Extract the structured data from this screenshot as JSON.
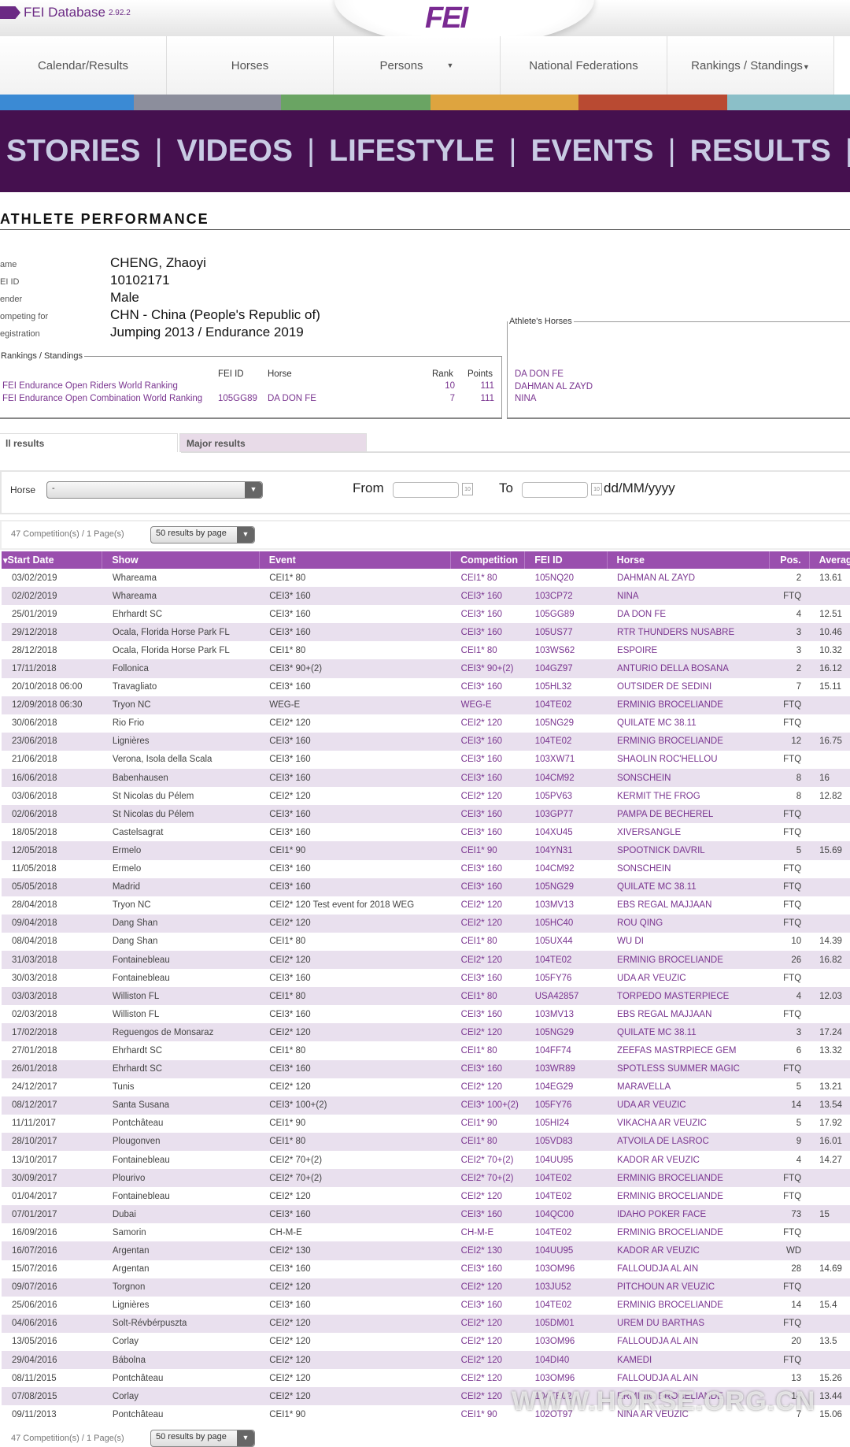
{
  "app": {
    "name": "FEI Database",
    "version": "2.92.2",
    "logo": "FEI"
  },
  "nav": [
    {
      "label": "Calendar/Results"
    },
    {
      "label": "Horses"
    },
    {
      "label": "Persons",
      "dropdown": true
    },
    {
      "label": "National Federations"
    },
    {
      "label": "Rankings / Standings",
      "dropdown": true
    }
  ],
  "stripe_colors": [
    "#3b8ad4",
    "#8c8e9c",
    "#6aa463",
    "#dea43f",
    "#b94a32",
    "#8bbfc8"
  ],
  "banner": [
    "STORIES",
    "VIDEOS",
    "LIFESTYLE",
    "EVENTS",
    "RESULTS"
  ],
  "page_title": "ATHLETE PERFORMANCE",
  "athlete": [
    {
      "label": "ame",
      "value": "CHENG, Zhaoyi"
    },
    {
      "label": "EI ID",
      "value": "10102171"
    },
    {
      "label": "ender",
      "value": "Male"
    },
    {
      "label": "ompeting for",
      "value": "CHN - China (People's Republic of)"
    },
    {
      "label": "egistration",
      "value": "Jumping 2013 / Endurance 2019"
    }
  ],
  "rankings": {
    "legend": "Rankings / Standings",
    "headers": {
      "fei_id": "FEI ID",
      "horse": "Horse",
      "rank": "Rank",
      "points": "Points"
    },
    "rows": [
      {
        "name": "FEI Endurance Open Riders World Ranking",
        "fei_id": "",
        "horse": "",
        "rank": "10",
        "points": "111"
      },
      {
        "name": "FEI Endurance Open Combination World Ranking",
        "fei_id": "105GG89",
        "horse": "DA DON FE",
        "rank": "7",
        "points": "111"
      }
    ]
  },
  "athletes_horses": {
    "legend": "Athlete's Horses",
    "items": [
      "DA DON FE",
      "DAHMAN AL ZAYD",
      "NINA"
    ]
  },
  "tabs": [
    {
      "label": "ll results",
      "active": true
    },
    {
      "label": "Major results",
      "active": false
    }
  ],
  "filter": {
    "horse_label": "Horse",
    "horse_value": "-",
    "from_label": "From",
    "to_label": "To",
    "date_format": "dd/MM/yyyy"
  },
  "summary": "47 Competition(s) / 1 Page(s)",
  "page_size": "50 results by page",
  "table": {
    "headers": [
      "Start Date",
      "Show",
      "Event",
      "Competition",
      "FEI ID",
      "Horse",
      "Pos.",
      "Average"
    ],
    "rows": [
      [
        "03/02/2019",
        "Whareama",
        "CEI1* 80",
        "CEI1* 80",
        "105NQ20",
        "DAHMAN AL ZAYD",
        "2",
        "13.61"
      ],
      [
        "02/02/2019",
        "Whareama",
        "CEI3* 160",
        "CEI3* 160",
        "103CP72",
        "NINA",
        "FTQ",
        ""
      ],
      [
        "25/01/2019",
        "Ehrhardt SC",
        "CEI3* 160",
        "CEI3* 160",
        "105GG89",
        "DA DON FE",
        "4",
        "12.51"
      ],
      [
        "29/12/2018",
        "Ocala, Florida Horse Park FL",
        "CEI3* 160",
        "CEI3* 160",
        "105US77",
        "RTR THUNDERS NUSABRE",
        "3",
        "10.46"
      ],
      [
        "28/12/2018",
        "Ocala, Florida Horse Park FL",
        "CEI1* 80",
        "CEI1* 80",
        "103WS62",
        "ESPOIRE",
        "3",
        "10.32"
      ],
      [
        "17/11/2018",
        "Follonica",
        "CEI3* 90+(2)",
        "CEI3* 90+(2)",
        "104GZ97",
        "ANTURIO DELLA BOSANA",
        "2",
        "16.12"
      ],
      [
        "20/10/2018 06:00",
        "Travagliato",
        "CEI3* 160",
        "CEI3* 160",
        "105HL32",
        "OUTSIDER DE SEDINI",
        "7",
        "15.11"
      ],
      [
        "12/09/2018 06:30",
        "Tryon NC",
        "WEG-E",
        "WEG-E",
        "104TE02",
        "ERMINIG BROCELIANDE",
        "FTQ",
        ""
      ],
      [
        "30/06/2018",
        "Rio Frio",
        "CEI2* 120",
        "CEI2* 120",
        "105NG29",
        "QUILATE MC 38.11",
        "FTQ",
        ""
      ],
      [
        "23/06/2018",
        "Lignières",
        "CEI3* 160",
        "CEI3* 160",
        "104TE02",
        "ERMINIG BROCELIANDE",
        "12",
        "16.75"
      ],
      [
        "21/06/2018",
        "Verona, Isola della Scala",
        "CEI3* 160",
        "CEI3* 160",
        "103XW71",
        "SHAOLIN ROC'HELLOU",
        "FTQ",
        ""
      ],
      [
        "16/06/2018",
        "Babenhausen",
        "CEI3* 160",
        "CEI3* 160",
        "104CM92",
        "SONSCHEIN",
        "8",
        "16"
      ],
      [
        "03/06/2018",
        "St Nicolas du Pélem",
        "CEI2* 120",
        "CEI2* 120",
        "105PV63",
        "KERMIT THE FROG",
        "8",
        "12.82"
      ],
      [
        "02/06/2018",
        "St Nicolas du Pélem",
        "CEI3* 160",
        "CEI3* 160",
        "103GP77",
        "PAMPA DE BECHEREL",
        "FTQ",
        ""
      ],
      [
        "18/05/2018",
        "Castelsagrat",
        "CEI3* 160",
        "CEI3* 160",
        "104XU45",
        "XIVERSANGLE",
        "FTQ",
        ""
      ],
      [
        "12/05/2018",
        "Ermelo",
        "CEI1* 90",
        "CEI1* 90",
        "104YN31",
        "SPOOTNICK DAVRIL",
        "5",
        "15.69"
      ],
      [
        "11/05/2018",
        "Ermelo",
        "CEI3* 160",
        "CEI3* 160",
        "104CM92",
        "SONSCHEIN",
        "FTQ",
        ""
      ],
      [
        "05/05/2018",
        "Madrid",
        "CEI3* 160",
        "CEI3* 160",
        "105NG29",
        "QUILATE MC 38.11",
        "FTQ",
        ""
      ],
      [
        "28/04/2018",
        "Tryon NC",
        "CEI2* 120 Test event for 2018 WEG",
        "CEI2* 120",
        "103MV13",
        "EBS REGAL MAJJAAN",
        "FTQ",
        ""
      ],
      [
        "09/04/2018",
        "Dang Shan",
        "CEI2* 120",
        "CEI2* 120",
        "105HC40",
        "ROU QING",
        "FTQ",
        ""
      ],
      [
        "08/04/2018",
        "Dang Shan",
        "CEI1* 80",
        "CEI1* 80",
        "105UX44",
        "WU DI",
        "10",
        "14.39"
      ],
      [
        "31/03/2018",
        "Fontainebleau",
        "CEI2* 120",
        "CEI2* 120",
        "104TE02",
        "ERMINIG BROCELIANDE",
        "26",
        "16.82"
      ],
      [
        "30/03/2018",
        "Fontainebleau",
        "CEI3* 160",
        "CEI3* 160",
        "105FY76",
        "UDA AR VEUZIC",
        "FTQ",
        ""
      ],
      [
        "03/03/2018",
        "Williston FL",
        "CEI1* 80",
        "CEI1* 80",
        "USA42857",
        "TORPEDO MASTERPIECE",
        "4",
        "12.03"
      ],
      [
        "02/03/2018",
        "Williston FL",
        "CEI3* 160",
        "CEI3* 160",
        "103MV13",
        "EBS REGAL MAJJAAN",
        "FTQ",
        ""
      ],
      [
        "17/02/2018",
        "Reguengos de Monsaraz",
        "CEI2* 120",
        "CEI2* 120",
        "105NG29",
        "QUILATE MC 38.11",
        "3",
        "17.24"
      ],
      [
        "27/01/2018",
        "Ehrhardt SC",
        "CEI1* 80",
        "CEI1* 80",
        "104FF74",
        "ZEEFAS MASTRPIECE GEM",
        "6",
        "13.32"
      ],
      [
        "26/01/2018",
        "Ehrhardt SC",
        "CEI3* 160",
        "CEI3* 160",
        "103WR89",
        "SPOTLESS SUMMER MAGIC",
        "FTQ",
        ""
      ],
      [
        "24/12/2017",
        "Tunis",
        "CEI2* 120",
        "CEI2* 120",
        "104EG29",
        "MARAVELLA",
        "5",
        "13.21"
      ],
      [
        "08/12/2017",
        "Santa Susana",
        "CEI3* 100+(2)",
        "CEI3* 100+(2)",
        "105FY76",
        "UDA AR VEUZIC",
        "14",
        "13.54"
      ],
      [
        "11/11/2017",
        "Pontchâteau",
        "CEI1* 90",
        "CEI1* 90",
        "105HI24",
        "VIKACHA AR VEUZIC",
        "5",
        "17.92"
      ],
      [
        "28/10/2017",
        "Plougonven",
        "CEI1* 80",
        "CEI1* 80",
        "105VD83",
        "ATVOILA DE LASROC",
        "9",
        "16.01"
      ],
      [
        "13/10/2017",
        "Fontainebleau",
        "CEI2* 70+(2)",
        "CEI2* 70+(2)",
        "104UU95",
        "KADOR AR VEUZIC",
        "4",
        "14.27"
      ],
      [
        "30/09/2017",
        "Plourivo",
        "CEI2* 70+(2)",
        "CEI2* 70+(2)",
        "104TE02",
        "ERMINIG BROCELIANDE",
        "FTQ",
        ""
      ],
      [
        "01/04/2017",
        "Fontainebleau",
        "CEI2* 120",
        "CEI2* 120",
        "104TE02",
        "ERMINIG BROCELIANDE",
        "FTQ",
        ""
      ],
      [
        "07/01/2017",
        "Dubai",
        "CEI3* 160",
        "CEI3* 160",
        "104QC00",
        "IDAHO POKER FACE",
        "73",
        "15"
      ],
      [
        "16/09/2016",
        "Samorin",
        "CH-M-E",
        "CH-M-E",
        "104TE02",
        "ERMINIG BROCELIANDE",
        "FTQ",
        ""
      ],
      [
        "16/07/2016",
        "Argentan",
        "CEI2* 130",
        "CEI2* 130",
        "104UU95",
        "KADOR AR VEUZIC",
        "WD",
        ""
      ],
      [
        "15/07/2016",
        "Argentan",
        "CEI3* 160",
        "CEI3* 160",
        "103OM96",
        "FALLOUDJA AL AIN",
        "28",
        "14.69"
      ],
      [
        "09/07/2016",
        "Torgnon",
        "CEI2* 120",
        "CEI2* 120",
        "103JU52",
        "PITCHOUN AR VEUZIC",
        "FTQ",
        ""
      ],
      [
        "25/06/2016",
        "Lignières",
        "CEI3* 160",
        "CEI3* 160",
        "104TE02",
        "ERMINIG BROCELIANDE",
        "14",
        "15.4"
      ],
      [
        "04/06/2016",
        "Solt-Révbérpuszta",
        "CEI2* 120",
        "CEI2* 120",
        "105DM01",
        "UREM DU BARTHAS",
        "FTQ",
        ""
      ],
      [
        "13/05/2016",
        "Corlay",
        "CEI2* 120",
        "CEI2* 120",
        "103OM96",
        "FALLOUDJA AL AIN",
        "20",
        "13.5"
      ],
      [
        "29/04/2016",
        "Bábolna",
        "CEI2* 120",
        "CEI2* 120",
        "104DI40",
        "KAMEDI",
        "FTQ",
        ""
      ],
      [
        "08/11/2015",
        "Pontchâteau",
        "CEI2* 120",
        "CEI2* 120",
        "103OM96",
        "FALLOUDJA AL AIN",
        "13",
        "15.26"
      ],
      [
        "07/08/2015",
        "Corlay",
        "CEI2* 120",
        "CEI2* 120",
        "104TE02",
        "ERMINIG BROCELIANDE",
        "14",
        "13.44"
      ],
      [
        "09/11/2013",
        "Pontchâteau",
        "CEI1* 90",
        "CEI1* 90",
        "102OT97",
        "NINA AR VEUZIC",
        "7",
        "15.06"
      ]
    ]
  },
  "watermark": "WWW.HORSE.ORG.CN",
  "colors": {
    "header_purple": "#9a4fae",
    "link_purple": "#7a3590",
    "banner": "#45104f",
    "row_alt": "#e9e0ee"
  }
}
